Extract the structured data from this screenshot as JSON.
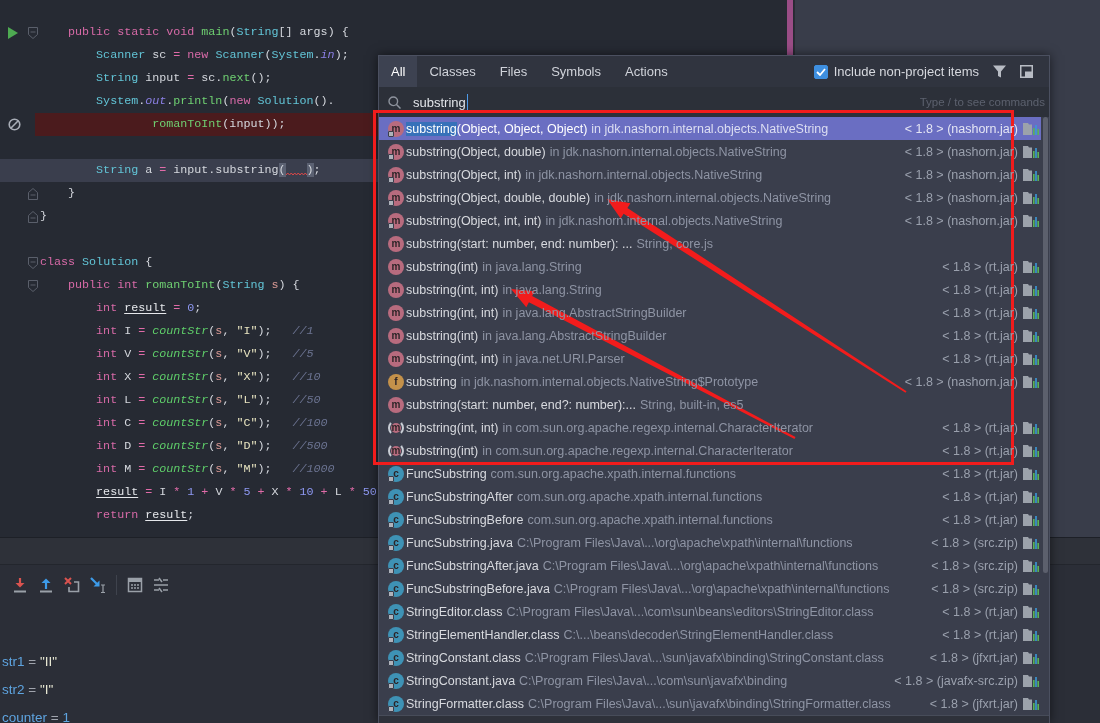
{
  "editor": {
    "lines": [
      {
        "kind": "code",
        "markers": [
          {
            "kind": "run"
          },
          {
            "kind": "fold-start"
          }
        ],
        "tokens": [
          {
            "kind": "keyword",
            "text": "    public "
          },
          {
            "kind": "keyword",
            "text": "static "
          },
          {
            "kind": "keyword",
            "text": "void "
          },
          {
            "kind": "function",
            "text": "main"
          },
          {
            "kind": "plain",
            "text": "("
          },
          {
            "kind": "type",
            "text": "String"
          },
          {
            "kind": "plain",
            "text": "[] args) {"
          }
        ]
      },
      {
        "kind": "code",
        "tokens": [
          {
            "kind": "type",
            "text": "        Scanner"
          },
          {
            "kind": "plain",
            "text": " sc "
          },
          {
            "kind": "operator",
            "text": "="
          },
          {
            "kind": "keyword",
            "text": " new "
          },
          {
            "kind": "type",
            "text": "Scanner"
          },
          {
            "kind": "plain",
            "text": "("
          },
          {
            "kind": "type",
            "text": "System"
          },
          {
            "kind": "plain",
            "text": "."
          },
          {
            "kind": "static",
            "text": "in"
          },
          {
            "kind": "plain",
            "text": ");"
          }
        ]
      },
      {
        "kind": "code",
        "tokens": [
          {
            "kind": "type",
            "text": "        String"
          },
          {
            "kind": "plain",
            "text": " input "
          },
          {
            "kind": "operator",
            "text": "="
          },
          {
            "kind": "plain",
            "text": " sc."
          },
          {
            "kind": "function",
            "text": "next"
          },
          {
            "kind": "plain",
            "text": "();"
          }
        ]
      },
      {
        "kind": "code",
        "tokens": [
          {
            "kind": "type",
            "text": "        System"
          },
          {
            "kind": "plain",
            "text": "."
          },
          {
            "kind": "static",
            "text": "out"
          },
          {
            "kind": "plain",
            "text": "."
          },
          {
            "kind": "function",
            "text": "println"
          },
          {
            "kind": "plain",
            "text": "("
          },
          {
            "kind": "keyword",
            "text": "new "
          },
          {
            "kind": "type",
            "text": "Solution"
          },
          {
            "kind": "plain",
            "text": "()."
          }
        ]
      },
      {
        "kind": "error-line",
        "markers": [
          {
            "kind": "breakpoint-muted"
          }
        ],
        "tokens": [
          {
            "kind": "function",
            "text": "                romanToInt"
          },
          {
            "kind": "plain",
            "text": "(input));"
          }
        ]
      },
      {
        "kind": "blank"
      },
      {
        "kind": "current-line",
        "tokens": [
          {
            "kind": "type",
            "text": "        String"
          },
          {
            "kind": "plain",
            "text": " a "
          },
          {
            "kind": "operator",
            "text": "="
          },
          {
            "kind": "plain",
            "text": " input.substring"
          },
          {
            "kind": "brace",
            "text": "(",
            "error_gap": true
          },
          {
            "kind": "brace",
            "text": ")"
          },
          {
            "kind": "plain",
            "text": ";"
          }
        ]
      },
      {
        "kind": "code",
        "markers": [
          {
            "kind": "fold-end"
          }
        ],
        "tokens": [
          {
            "kind": "plain",
            "text": "    }"
          }
        ]
      },
      {
        "kind": "code",
        "markers": [
          {
            "kind": "fold-end"
          }
        ],
        "tokens": [
          {
            "kind": "plain",
            "text": "}"
          }
        ]
      },
      {
        "kind": "blank"
      },
      {
        "kind": "code",
        "markers": [
          {
            "kind": "fold-start"
          }
        ],
        "tokens": [
          {
            "kind": "keyword",
            "text": "class "
          },
          {
            "kind": "type",
            "text": "Solution"
          },
          {
            "kind": "plain",
            "text": " {"
          }
        ]
      },
      {
        "kind": "code",
        "markers": [
          {
            "kind": "fold-start"
          }
        ],
        "tokens": [
          {
            "kind": "keyword",
            "text": "    public "
          },
          {
            "kind": "keyword",
            "text": "int "
          },
          {
            "kind": "function",
            "text": "romanToInt"
          },
          {
            "kind": "plain",
            "text": "("
          },
          {
            "kind": "type",
            "text": "String "
          },
          {
            "kind": "param",
            "text": "s"
          },
          {
            "kind": "plain",
            "text": ") {"
          }
        ]
      },
      {
        "kind": "code",
        "tokens": [
          {
            "kind": "keyword",
            "text": "        int "
          },
          {
            "kind": "var",
            "text": "result"
          },
          {
            "kind": "operator",
            "text": " = "
          },
          {
            "kind": "number",
            "text": "0"
          },
          {
            "kind": "plain",
            "text": ";"
          }
        ]
      },
      {
        "kind": "code",
        "tokens": [
          {
            "kind": "keyword",
            "text": "        int"
          },
          {
            "kind": "plain",
            "text": " I "
          },
          {
            "kind": "operator",
            "text": "="
          },
          {
            "kind": "call",
            "text": " countStr"
          },
          {
            "kind": "plain",
            "text": "("
          },
          {
            "kind": "param",
            "text": "s"
          },
          {
            "kind": "plain",
            "text": ", "
          },
          {
            "kind": "string",
            "text": "\"I\""
          },
          {
            "kind": "plain",
            "text": ");   "
          },
          {
            "kind": "comment",
            "text": "//1"
          }
        ]
      },
      {
        "kind": "code",
        "tokens": [
          {
            "kind": "keyword",
            "text": "        int"
          },
          {
            "kind": "plain",
            "text": " V "
          },
          {
            "kind": "operator",
            "text": "="
          },
          {
            "kind": "call",
            "text": " countStr"
          },
          {
            "kind": "plain",
            "text": "("
          },
          {
            "kind": "param",
            "text": "s"
          },
          {
            "kind": "plain",
            "text": ", "
          },
          {
            "kind": "string",
            "text": "\"V\""
          },
          {
            "kind": "plain",
            "text": ");   "
          },
          {
            "kind": "comment",
            "text": "//5"
          }
        ]
      },
      {
        "kind": "code",
        "tokens": [
          {
            "kind": "keyword",
            "text": "        int"
          },
          {
            "kind": "plain",
            "text": " X "
          },
          {
            "kind": "operator",
            "text": "="
          },
          {
            "kind": "call",
            "text": " countStr"
          },
          {
            "kind": "plain",
            "text": "("
          },
          {
            "kind": "param",
            "text": "s"
          },
          {
            "kind": "plain",
            "text": ", "
          },
          {
            "kind": "string",
            "text": "\"X\""
          },
          {
            "kind": "plain",
            "text": ");   "
          },
          {
            "kind": "comment",
            "text": "//10"
          }
        ]
      },
      {
        "kind": "code",
        "tokens": [
          {
            "kind": "keyword",
            "text": "        int"
          },
          {
            "kind": "plain",
            "text": " L "
          },
          {
            "kind": "operator",
            "text": "="
          },
          {
            "kind": "call",
            "text": " countStr"
          },
          {
            "kind": "plain",
            "text": "("
          },
          {
            "kind": "param",
            "text": "s"
          },
          {
            "kind": "plain",
            "text": ", "
          },
          {
            "kind": "string",
            "text": "\"L\""
          },
          {
            "kind": "plain",
            "text": ");   "
          },
          {
            "kind": "comment",
            "text": "//50"
          }
        ]
      },
      {
        "kind": "code",
        "tokens": [
          {
            "kind": "keyword",
            "text": "        int"
          },
          {
            "kind": "plain",
            "text": " C "
          },
          {
            "kind": "operator",
            "text": "="
          },
          {
            "kind": "call",
            "text": " countStr"
          },
          {
            "kind": "plain",
            "text": "("
          },
          {
            "kind": "param",
            "text": "s"
          },
          {
            "kind": "plain",
            "text": ", "
          },
          {
            "kind": "string",
            "text": "\"C\""
          },
          {
            "kind": "plain",
            "text": ");   "
          },
          {
            "kind": "comment",
            "text": "//100"
          }
        ]
      },
      {
        "kind": "code",
        "tokens": [
          {
            "kind": "keyword",
            "text": "        int"
          },
          {
            "kind": "plain",
            "text": " D "
          },
          {
            "kind": "operator",
            "text": "="
          },
          {
            "kind": "call",
            "text": " countStr"
          },
          {
            "kind": "plain",
            "text": "("
          },
          {
            "kind": "param",
            "text": "s"
          },
          {
            "kind": "plain",
            "text": ", "
          },
          {
            "kind": "string",
            "text": "\"D\""
          },
          {
            "kind": "plain",
            "text": ");   "
          },
          {
            "kind": "comment",
            "text": "//500"
          }
        ]
      },
      {
        "kind": "code",
        "tokens": [
          {
            "kind": "keyword",
            "text": "        int"
          },
          {
            "kind": "plain",
            "text": " M "
          },
          {
            "kind": "operator",
            "text": "="
          },
          {
            "kind": "call",
            "text": " countStr"
          },
          {
            "kind": "plain",
            "text": "("
          },
          {
            "kind": "param",
            "text": "s"
          },
          {
            "kind": "plain",
            "text": ", "
          },
          {
            "kind": "string",
            "text": "\"M\""
          },
          {
            "kind": "plain",
            "text": ");   "
          },
          {
            "kind": "comment",
            "text": "//1000"
          }
        ]
      },
      {
        "kind": "code",
        "tokens": [
          {
            "kind": "var",
            "text": "        result"
          },
          {
            "kind": "operator",
            "text": " = "
          },
          {
            "kind": "plain",
            "text": "I "
          },
          {
            "kind": "operator",
            "text": "*"
          },
          {
            "kind": "number",
            "text": " 1"
          },
          {
            "kind": "operator",
            "text": " +"
          },
          {
            "kind": "plain",
            "text": " V "
          },
          {
            "kind": "operator",
            "text": "*"
          },
          {
            "kind": "number",
            "text": " 5"
          },
          {
            "kind": "operator",
            "text": " +"
          },
          {
            "kind": "plain",
            "text": " X "
          },
          {
            "kind": "operator",
            "text": "*"
          },
          {
            "kind": "number",
            "text": " 10"
          },
          {
            "kind": "operator",
            "text": " +"
          },
          {
            "kind": "plain",
            "text": " L "
          },
          {
            "kind": "operator",
            "text": "*"
          },
          {
            "kind": "number",
            "text": " 50"
          }
        ]
      },
      {
        "kind": "code",
        "tokens": [
          {
            "kind": "keyword",
            "text": "        return "
          },
          {
            "kind": "var",
            "text": "result"
          },
          {
            "kind": "plain",
            "text": ";"
          }
        ]
      }
    ]
  },
  "debugger": {
    "toolbar": [
      {
        "kind": "download"
      },
      {
        "kind": "upload"
      },
      {
        "kind": "cross-box"
      },
      {
        "kind": "arrow-cursor"
      },
      {
        "kind": "separator"
      },
      {
        "kind": "calculator"
      },
      {
        "kind": "list"
      }
    ],
    "variables": [
      {
        "name": "str1",
        "sep": "=",
        "value": "\"II\"",
        "kind": "string"
      },
      {
        "name": "str2",
        "sep": "=",
        "value": "\"I\"",
        "kind": "string"
      },
      {
        "name": "counter",
        "sep": "=",
        "value": "1",
        "kind": "number"
      }
    ]
  },
  "search_popup": {
    "tabs": [
      {
        "label": "All",
        "selected": true
      },
      {
        "label": "Classes",
        "selected": false
      },
      {
        "label": "Files",
        "selected": false
      },
      {
        "label": "Symbols",
        "selected": false
      },
      {
        "label": "Actions",
        "selected": false
      }
    ],
    "include_option": {
      "label": "Include non-project items",
      "checked": true
    },
    "query": "substring",
    "hint": "Type / to see commands",
    "results": [
      {
        "kind": "method",
        "icon": "m",
        "locked": true,
        "selected": true,
        "match": "substring",
        "name": "(Object, Object, Object)",
        "location": "in jdk.nashorn.internal.objects.NativeString",
        "library": "< 1.8 > (nashorn.jar)"
      },
      {
        "kind": "method",
        "icon": "m",
        "locked": true,
        "selected": false,
        "name": "substring(Object, double)",
        "location": "in jdk.nashorn.internal.objects.NativeString",
        "library": "< 1.8 > (nashorn.jar)"
      },
      {
        "kind": "method",
        "icon": "m",
        "locked": true,
        "selected": false,
        "name": "substring(Object, int)",
        "location": "in jdk.nashorn.internal.objects.NativeString",
        "library": "< 1.8 > (nashorn.jar)"
      },
      {
        "kind": "method",
        "icon": "m",
        "locked": true,
        "selected": false,
        "name": "substring(Object, double, double)",
        "location": "in jdk.nashorn.internal.objects.NativeString",
        "library": "< 1.8 > (nashorn.jar)"
      },
      {
        "kind": "method",
        "icon": "m",
        "locked": true,
        "selected": false,
        "name": "substring(Object, int, int)",
        "location": "in jdk.nashorn.internal.objects.NativeString",
        "library": "< 1.8 > (nashorn.jar)"
      },
      {
        "kind": "method",
        "icon": "m",
        "locked": false,
        "selected": false,
        "name": "substring(start: number, end: number): ...",
        "location": "String, core.js"
      },
      {
        "kind": "method",
        "icon": "m",
        "locked": false,
        "selected": false,
        "name": "substring(int)",
        "location": "in java.lang.String",
        "library": "< 1.8 > (rt.jar)"
      },
      {
        "kind": "method",
        "icon": "m",
        "locked": false,
        "selected": false,
        "name": "substring(int, int)",
        "location": "in java.lang.String",
        "library": "< 1.8 > (rt.jar)"
      },
      {
        "kind": "method",
        "icon": "m",
        "locked": false,
        "selected": false,
        "name": "substring(int, int)",
        "location": "in java.lang.AbstractStringBuilder",
        "library": "< 1.8 > (rt.jar)"
      },
      {
        "kind": "method",
        "icon": "m",
        "locked": false,
        "selected": false,
        "name": "substring(int)",
        "location": "in java.lang.AbstractStringBuilder",
        "library": "< 1.8 > (rt.jar)"
      },
      {
        "kind": "method",
        "icon": "m",
        "locked": false,
        "selected": false,
        "name": "substring(int, int)",
        "location": "in java.net.URI.Parser",
        "library": "< 1.8 > (rt.jar)"
      },
      {
        "kind": "field",
        "icon": "f",
        "locked": false,
        "selected": false,
        "name": "substring",
        "location": "in jdk.nashorn.internal.objects.NativeString$Prototype",
        "library": "< 1.8 > (nashorn.jar)"
      },
      {
        "kind": "method",
        "icon": "m",
        "locked": false,
        "selected": false,
        "name": "substring(start: number, end?: number):...",
        "location": "String, built-in, es5"
      },
      {
        "kind": "abstract-method",
        "icon": "m",
        "locked": false,
        "selected": false,
        "name": "substring(int, int)",
        "location": "in com.sun.org.apache.regexp.internal.CharacterIterator",
        "library": "< 1.8 > (rt.jar)"
      },
      {
        "kind": "abstract-method",
        "icon": "m",
        "locked": false,
        "selected": false,
        "name": "substring(int)",
        "location": "in com.sun.org.apache.regexp.internal.CharacterIterator",
        "library": "< 1.8 > (rt.jar)"
      },
      {
        "kind": "class",
        "icon": "c",
        "locked": true,
        "selected": false,
        "name": "FuncSubstring",
        "location": "com.sun.org.apache.xpath.internal.functions",
        "library": "< 1.8 > (rt.jar)"
      },
      {
        "kind": "class",
        "icon": "c",
        "locked": true,
        "selected": false,
        "name": "FuncSubstringAfter",
        "location": "com.sun.org.apache.xpath.internal.functions",
        "library": "< 1.8 > (rt.jar)"
      },
      {
        "kind": "class",
        "icon": "c",
        "locked": true,
        "selected": false,
        "name": "FuncSubstringBefore",
        "location": "com.sun.org.apache.xpath.internal.functions",
        "library": "< 1.8 > (rt.jar)"
      },
      {
        "kind": "class",
        "icon": "c",
        "locked": true,
        "selected": false,
        "name": "FuncSubstring.java",
        "location": "C:\\Program Files\\Java\\...\\org\\apache\\xpath\\internal\\functions",
        "library": "< 1.8 > (src.zip)"
      },
      {
        "kind": "class",
        "icon": "c",
        "locked": true,
        "selected": false,
        "name": "FuncSubstringAfter.java",
        "location": "C:\\Program Files\\Java\\...\\org\\apache\\xpath\\internal\\functions",
        "library": "< 1.8 > (src.zip)"
      },
      {
        "kind": "class",
        "icon": "c",
        "locked": true,
        "selected": false,
        "name": "FuncSubstringBefore.java",
        "location": "C:\\Program Files\\Java\\...\\org\\apache\\xpath\\internal\\functions",
        "library": "< 1.8 > (src.zip)"
      },
      {
        "kind": "class",
        "icon": "c",
        "locked": true,
        "selected": false,
        "name": "StringEditor.class",
        "location": "C:\\Program Files\\Java\\...\\com\\sun\\beans\\editors\\StringEditor.class",
        "library": "< 1.8 > (rt.jar)"
      },
      {
        "kind": "class",
        "icon": "c",
        "locked": true,
        "selected": false,
        "name": "StringElementHandler.class",
        "location": "C:\\...\\beans\\decoder\\StringElementHandler.class",
        "library": "< 1.8 > (rt.jar)"
      },
      {
        "kind": "class",
        "icon": "c",
        "locked": true,
        "selected": false,
        "name": "StringConstant.class",
        "location": "C:\\Program Files\\Java\\...\\sun\\javafx\\binding\\StringConstant.class",
        "library": "< 1.8 > (jfxrt.jar)"
      },
      {
        "kind": "class",
        "icon": "c",
        "locked": true,
        "selected": false,
        "name": "StringConstant.java",
        "location": "C:\\Program Files\\Java\\...\\com\\sun\\javafx\\binding",
        "library": "< 1.8 > (javafx-src.zip)"
      },
      {
        "kind": "class",
        "icon": "c",
        "locked": true,
        "selected": false,
        "name": "StringFormatter.class",
        "location": "C:\\Program Files\\Java\\...\\sun\\javafx\\binding\\StringFormatter.class",
        "library": "< 1.8 > (jfxrt.jar)"
      }
    ]
  }
}
